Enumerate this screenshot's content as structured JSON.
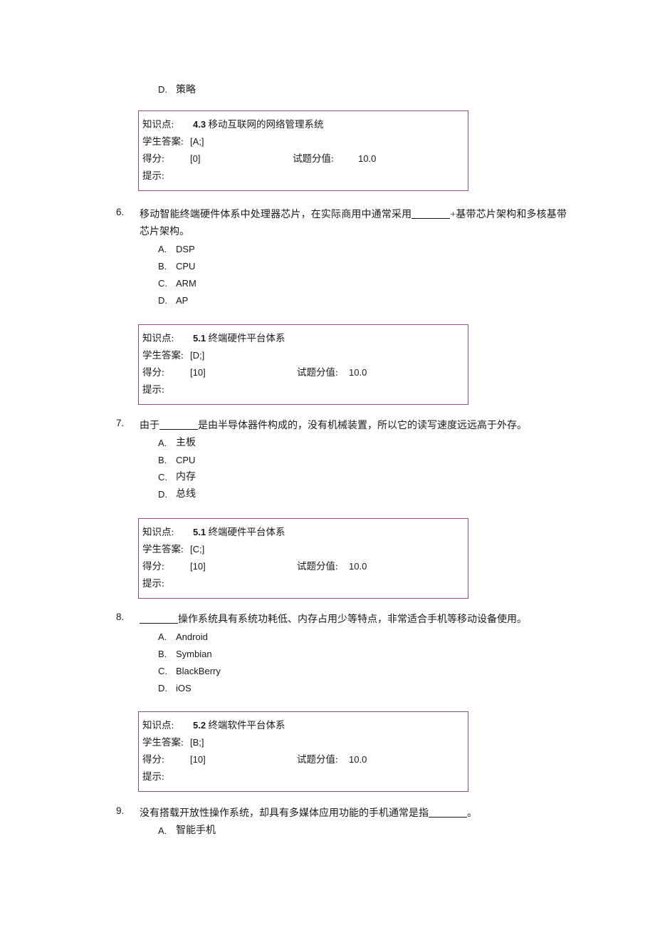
{
  "document": {
    "type": "exam-review-sheet",
    "language": "zh-CN",
    "accent_color": "#8e4f86",
    "text_color": "#1a1a1a"
  },
  "labels": {
    "knowledge_point": "知识点:",
    "student_answer": "学生答案:",
    "score": "得分:",
    "question_value": "试题分值:",
    "hint": "提示:"
  },
  "orphan_option": {
    "letter": "D.",
    "text": "策略"
  },
  "answer_box_5": {
    "knowledge_point_num": "4.3",
    "knowledge_point_text": "移动互联网的网络管理系统",
    "student_answer": "[A;]",
    "score": "[0]",
    "question_value": "10.0",
    "hint": ""
  },
  "questions": [
    {
      "number": "6.",
      "text_parts": [
        {
          "t": "text",
          "v": "移动智能终端硬件体系中处理器芯片，在实际商用中通常采用"
        },
        {
          "t": "blank",
          "v": ""
        },
        {
          "t": "text",
          "v": "+基带芯片架构和多核基带芯片架构。"
        }
      ],
      "text_plain": "移动智能终端硬件体系中处理器芯片，在实际商用中通常采用______+基带芯片架构和多核基带芯片架构。",
      "options": [
        {
          "letter": "A.",
          "text": "DSP",
          "script": "latin"
        },
        {
          "letter": "B.",
          "text": "CPU",
          "script": "latin"
        },
        {
          "letter": "C.",
          "text": "ARM",
          "script": "latin"
        },
        {
          "letter": "D.",
          "text": "AP",
          "script": "latin"
        }
      ],
      "answer_box": {
        "knowledge_point_num": "5.1",
        "knowledge_point_text": "终端硬件平台体系",
        "student_answer": "[D;]",
        "score": "[10]",
        "question_value": "10.0",
        "hint": ""
      }
    },
    {
      "number": "7.",
      "text_parts": [
        {
          "t": "text",
          "v": "由于"
        },
        {
          "t": "blank",
          "v": ""
        },
        {
          "t": "text",
          "v": "是由半导体器件构成的，没有机械装置，所以它的读写速度远远高于外存。"
        }
      ],
      "text_plain": "由于______是由半导体器件构成的，没有机械装置，所以它的读写速度远远高于外存。",
      "options": [
        {
          "letter": "A.",
          "text": "主板",
          "script": "cjk"
        },
        {
          "letter": "B.",
          "text": "CPU",
          "script": "latin"
        },
        {
          "letter": "C.",
          "text": "内存",
          "script": "cjk"
        },
        {
          "letter": "D.",
          "text": "总线",
          "script": "cjk"
        }
      ],
      "answer_box": {
        "knowledge_point_num": "5.1",
        "knowledge_point_text": "终端硬件平台体系",
        "student_answer": "[C;]",
        "score": "[10]",
        "question_value": "10.0",
        "hint": ""
      }
    },
    {
      "number": "8.",
      "text_parts": [
        {
          "t": "blank",
          "v": ""
        },
        {
          "t": "text",
          "v": "操作系统具有系统功耗低、内存占用少等特点，非常适合手机等移动设备使用。"
        }
      ],
      "text_plain": "______操作系统具有系统功耗低、内存占用少等特点，非常适合手机等移动设备使用。",
      "options": [
        {
          "letter": "A.",
          "text": "Android",
          "script": "latin"
        },
        {
          "letter": "B.",
          "text": "Symbian",
          "script": "latin"
        },
        {
          "letter": "C.",
          "text": "BlackBerry",
          "script": "latin"
        },
        {
          "letter": "D.",
          "text": "iOS",
          "script": "latin"
        }
      ],
      "answer_box": {
        "knowledge_point_num": "5.2",
        "knowledge_point_text": "终端软件平台体系",
        "student_answer": "[B;]",
        "score": "[10]",
        "question_value": "10.0",
        "hint": ""
      }
    },
    {
      "number": "9.",
      "text_parts": [
        {
          "t": "text",
          "v": "没有搭载开放性操作系统，却具有多媒体应用功能的手机通常是指"
        },
        {
          "t": "blank",
          "v": ""
        },
        {
          "t": "text",
          "v": "。"
        }
      ],
      "text_plain": "没有搭载开放性操作系统，却具有多媒体应用功能的手机通常是指________。",
      "options": [
        {
          "letter": "A.",
          "text": "智能手机",
          "script": "cjk"
        }
      ],
      "answer_box": null
    }
  ]
}
